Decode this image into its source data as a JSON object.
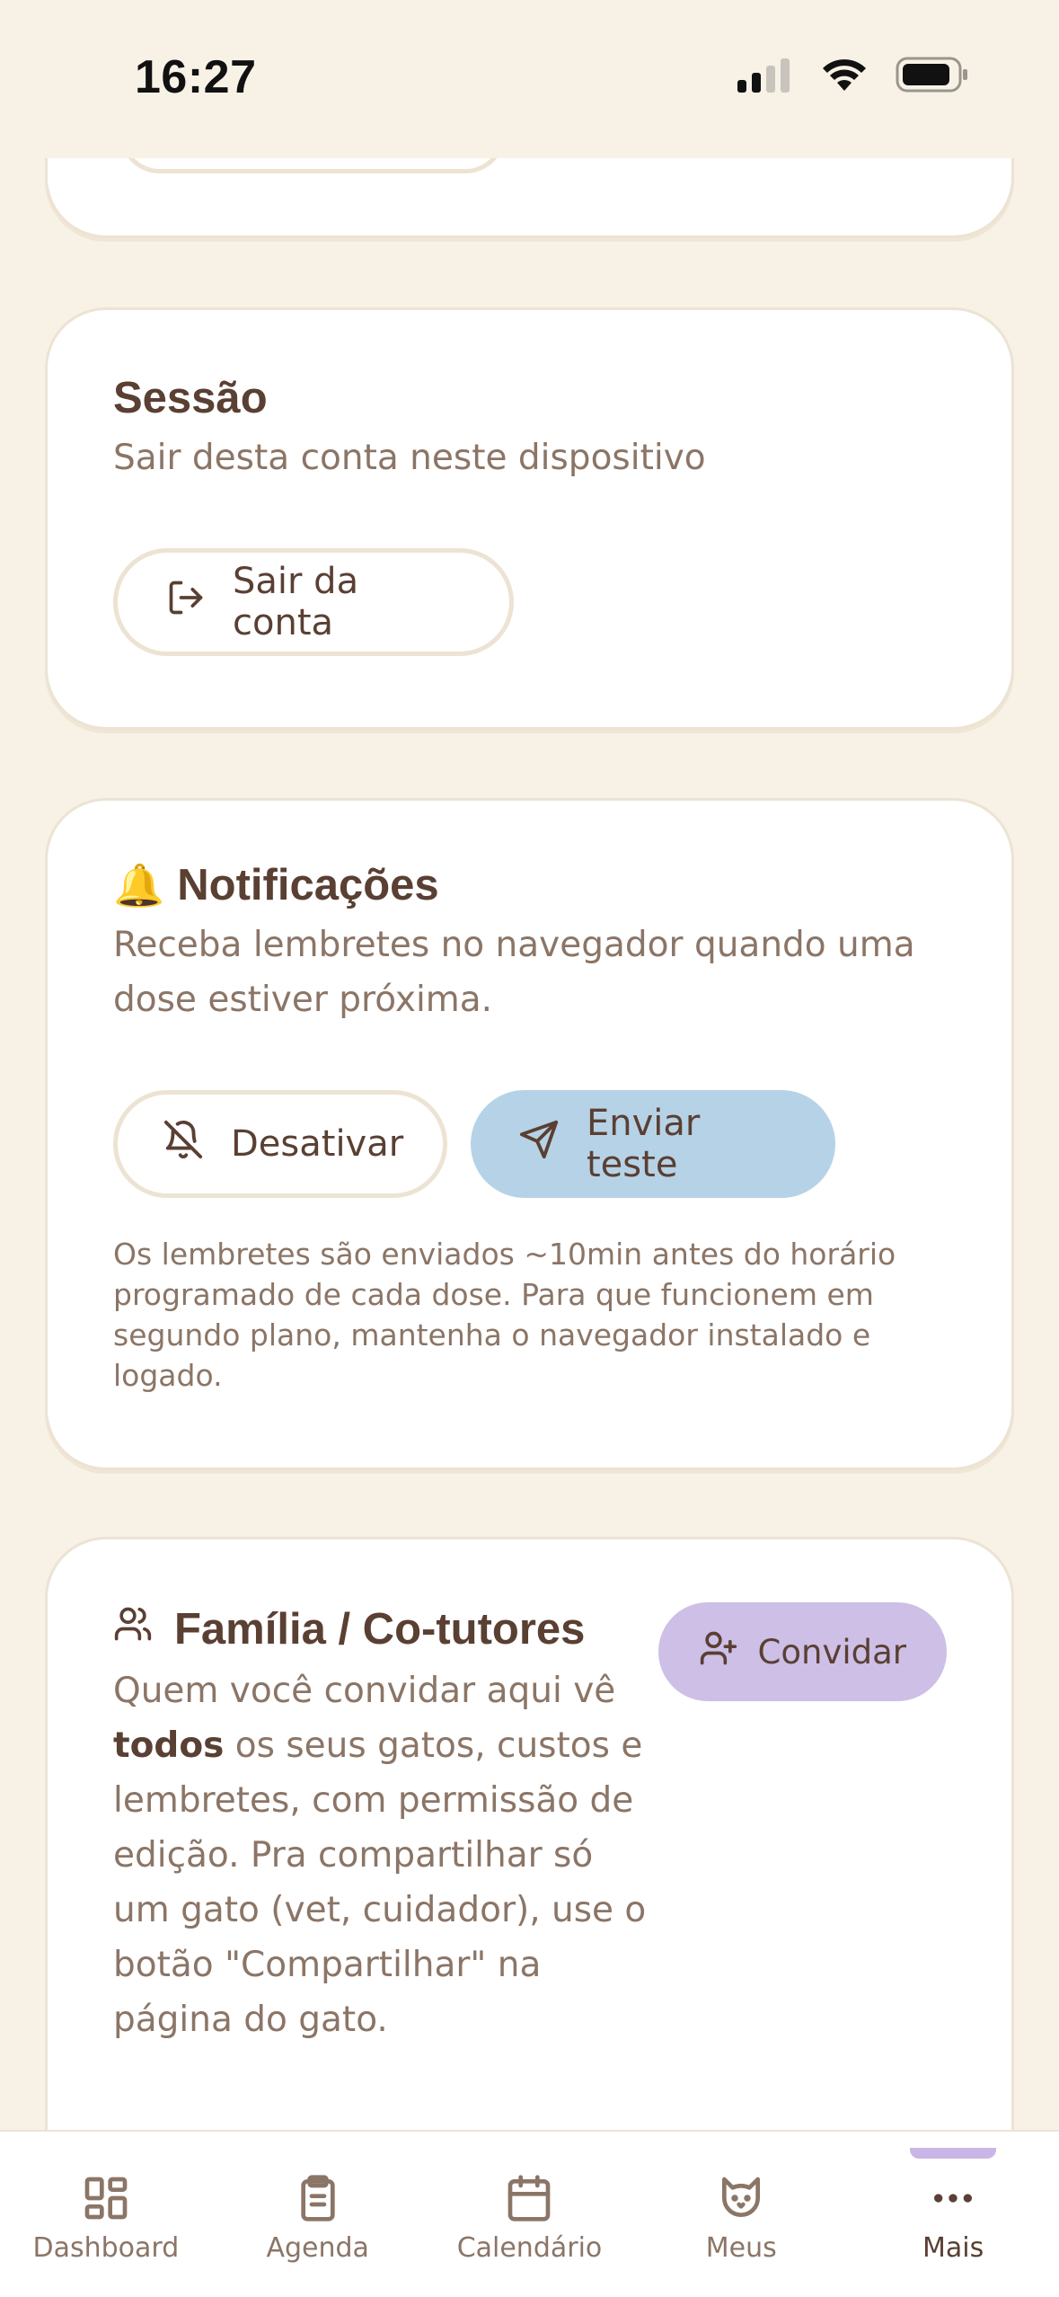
{
  "status_bar": {
    "time": "16:27"
  },
  "session": {
    "title": "Sessão",
    "subtitle": "Sair desta conta neste dispositivo",
    "logout_label": "Sair da conta"
  },
  "notifications": {
    "emoji": "🔔",
    "title": "Notificações",
    "subtitle": "Receba lembretes no navegador quando uma dose estiver próxima.",
    "disable_label": "Desativar",
    "test_label": "Enviar teste",
    "note": "Os lembretes são enviados ~10min antes do horário programado de cada dose. Para que funcionem em segundo plano, mantenha o navegador instalado e logado."
  },
  "family": {
    "title": "Família / Co-tutores",
    "invite_label": "Convidar",
    "desc_before": "Quem você convidar aqui vê ",
    "desc_bold": "todos",
    "desc_after": " os seus gatos, custos e lembretes, com permissão de edição. Pra compartilhar só um gato (vet, cuidador), use o botão \"Compartilhar\" na página do gato."
  },
  "tabbar": {
    "items": [
      {
        "label": "Dashboard",
        "icon": "dashboard-icon"
      },
      {
        "label": "Agenda",
        "icon": "clipboard-icon"
      },
      {
        "label": "Calendário",
        "icon": "calendar-icon"
      },
      {
        "label": "Meus",
        "icon": "cat-icon"
      },
      {
        "label": "Mais",
        "icon": "more-icon",
        "active": true
      }
    ]
  },
  "colors": {
    "background": "#f8f2e6",
    "card": "#ffffff",
    "text": "#5a3f33",
    "blue_button": "#b6d2e6",
    "lilac_button": "#cdbfe6"
  }
}
